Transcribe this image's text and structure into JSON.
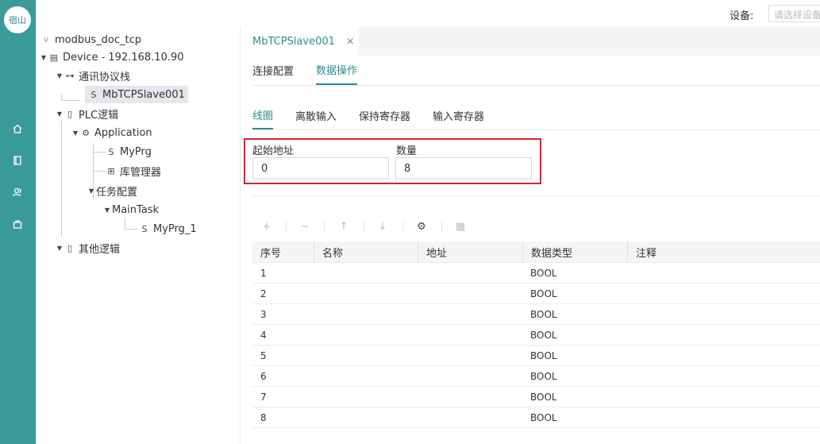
{
  "app": {
    "logo_text": "宿山"
  },
  "rail_icons": [
    "home-icon",
    "book-icon",
    "users-icon",
    "bag-icon"
  ],
  "topbar": {
    "device_label": "设备:",
    "device_placeholder": "请选择设备"
  },
  "tree": {
    "project": "modbus_doc_tcp",
    "device": "Device - 192.168.10.90",
    "comm_stack": "通讯协议栈",
    "slave": "MbTCPSlave001",
    "plc_logic": "PLC逻辑",
    "application": "Application",
    "myprg": "MyPrg",
    "library": "库管理器",
    "task_config": "任务配置",
    "main_task": "MainTask",
    "myprg_1": "MyPrg_1",
    "other_logic": "其他逻辑"
  },
  "doc_tab": {
    "label": "MbTCPSlave001",
    "close": "×"
  },
  "tabs_l1": [
    {
      "label": "连接配置"
    },
    {
      "label": "数据操作"
    }
  ],
  "tabs_l2": [
    {
      "label": "线圈"
    },
    {
      "label": "离散输入"
    },
    {
      "label": "保持寄存器"
    },
    {
      "label": "输入寄存器"
    }
  ],
  "form": {
    "start_label": "起始地址",
    "start_value": "0",
    "count_label": "数量",
    "count_value": "8"
  },
  "table": {
    "headers": [
      "序号",
      "名称",
      "地址",
      "数据类型",
      "注释"
    ],
    "rows": [
      [
        "1",
        "",
        "",
        "BOOL",
        ""
      ],
      [
        "2",
        "",
        "",
        "BOOL",
        ""
      ],
      [
        "3",
        "",
        "",
        "BOOL",
        ""
      ],
      [
        "4",
        "",
        "",
        "BOOL",
        ""
      ],
      [
        "5",
        "",
        "",
        "BOOL",
        ""
      ],
      [
        "6",
        "",
        "",
        "BOOL",
        ""
      ],
      [
        "7",
        "",
        "",
        "BOOL",
        ""
      ],
      [
        "8",
        "",
        "",
        "BOOL",
        ""
      ]
    ]
  },
  "colors": {
    "rail": "#3a9a9a",
    "accent": "#2f8c8c",
    "highlight_border": "#d9232d"
  }
}
